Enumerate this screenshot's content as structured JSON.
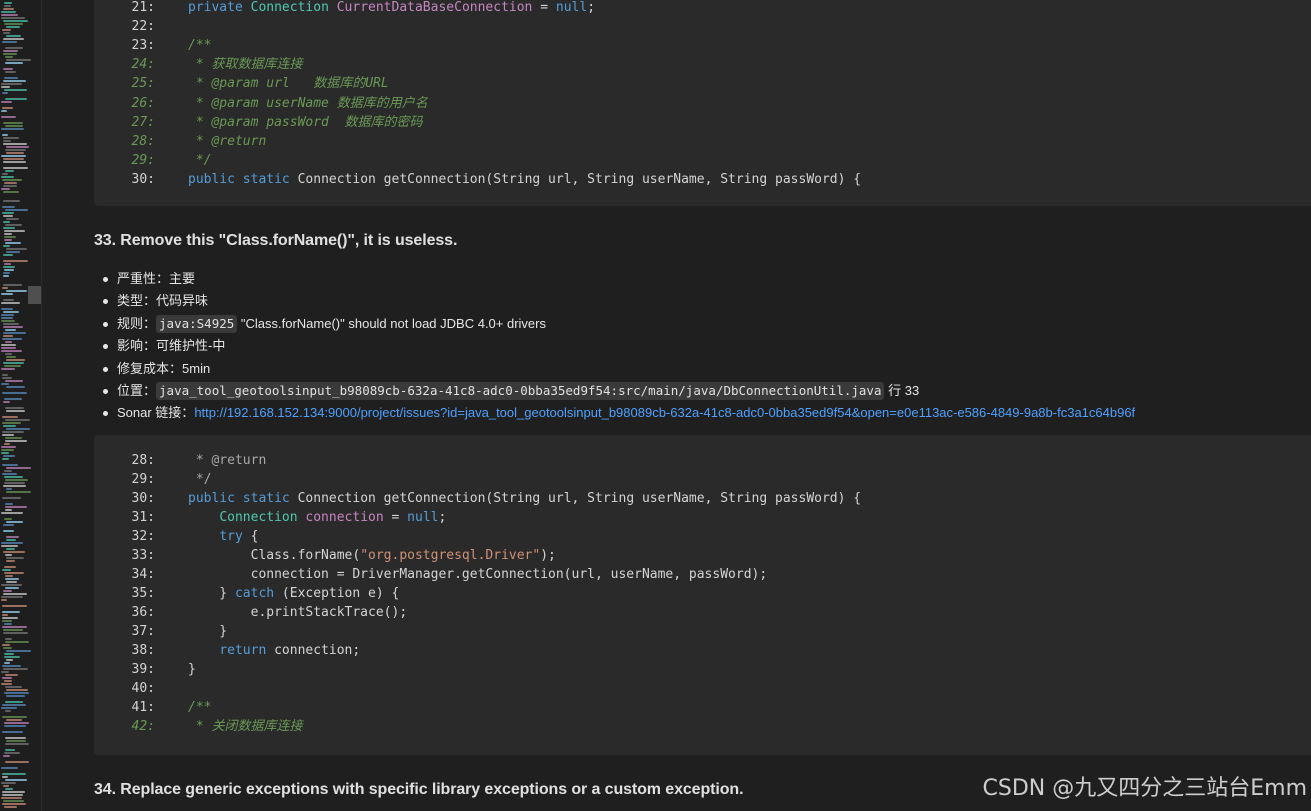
{
  "code_top": {
    "lines": [
      {
        "n": "21:",
        "tokens": [
          {
            "c": "kw",
            "t": "private "
          },
          {
            "c": "type",
            "t": "Connection "
          },
          {
            "c": "var",
            "t": "CurrentDataBaseConnection"
          },
          {
            "c": "plain",
            "t": " = "
          },
          {
            "c": "kw",
            "t": "null"
          },
          {
            "c": "plain",
            "t": ";"
          }
        ]
      },
      {
        "n": "22:",
        "tokens": []
      },
      {
        "n": "23:",
        "tokens": [
          {
            "c": "cmt",
            "t": "/**"
          }
        ]
      },
      {
        "n": "24:",
        "ln": "cm",
        "tokens": [
          {
            "c": "cmt",
            "t": " * 获取数据库连接"
          }
        ]
      },
      {
        "n": "25:",
        "ln": "cm",
        "tokens": [
          {
            "c": "cmt",
            "t": " * @param url   数据库的URL"
          }
        ]
      },
      {
        "n": "26:",
        "ln": "cm",
        "tokens": [
          {
            "c": "cmt",
            "t": " * @param userName 数据库的用户名"
          }
        ]
      },
      {
        "n": "27:",
        "ln": "cm",
        "tokens": [
          {
            "c": "cmt",
            "t": " * @param passWord  数据库的密码"
          }
        ]
      },
      {
        "n": "28:",
        "ln": "cm",
        "tokens": [
          {
            "c": "cmt",
            "t": " * @return"
          }
        ]
      },
      {
        "n": "29:",
        "ln": "cm",
        "tokens": [
          {
            "c": "cmt",
            "t": " */"
          }
        ]
      },
      {
        "n": "30:",
        "tokens": [
          {
            "c": "kw",
            "t": "public "
          },
          {
            "c": "kw",
            "t": "static "
          },
          {
            "c": "plain",
            "t": "Connection getConnection(String url, String userName, String passWord) {"
          }
        ]
      }
    ]
  },
  "issue": {
    "title": "33. Remove this \"Class.forName()\", it is useless.",
    "severity_label": "严重性：",
    "severity": "主要",
    "type_label": "类型：",
    "type": "代码异味",
    "rule_label": "规则：",
    "rule_code": "java:S4925",
    "rule_desc": " \"Class.forName()\" should not load JDBC 4.0+ drivers",
    "impact_label": "影响：",
    "impact": "可维护性-中",
    "cost_label": "修复成本：",
    "cost": "5min",
    "location_label": "位置：",
    "location_code": "java_tool_geotoolsinput_b98089cb-632a-41c8-adc0-0bba35ed9f54:src/main/java/DbConnectionUtil.java",
    "location_line": " 行 33",
    "sonar_label": "Sonar 链接：",
    "sonar_url": "http://192.168.152.134:9000/project/issues?id=java_tool_geotoolsinput_b98089cb-632a-41c8-adc0-0bba35ed9f54&open=e0e113ac-e586-4849-9a8b-fc3a1c64b96f"
  },
  "code_bottom": {
    "lines": [
      {
        "n": "28:",
        "tokens": [
          {
            "c": "cmtg",
            "t": " * @return"
          }
        ]
      },
      {
        "n": "29:",
        "tokens": [
          {
            "c": "cmtg",
            "t": " */"
          }
        ]
      },
      {
        "n": "30:",
        "tokens": [
          {
            "c": "kw",
            "t": "public "
          },
          {
            "c": "kw",
            "t": "static "
          },
          {
            "c": "plain",
            "t": "Connection getConnection(String url, String userName, String passWord) {"
          }
        ]
      },
      {
        "n": "31:",
        "tokens": [
          {
            "c": "plain",
            "t": "    "
          },
          {
            "c": "type",
            "t": "Connection "
          },
          {
            "c": "var",
            "t": "connection"
          },
          {
            "c": "plain",
            "t": " = "
          },
          {
            "c": "kw",
            "t": "null"
          },
          {
            "c": "plain",
            "t": ";"
          }
        ]
      },
      {
        "n": "32:",
        "tokens": [
          {
            "c": "plain",
            "t": "    "
          },
          {
            "c": "kw",
            "t": "try"
          },
          {
            "c": "plain",
            "t": " {"
          }
        ]
      },
      {
        "n": "33:",
        "tokens": [
          {
            "c": "plain",
            "t": "        Class.forName("
          },
          {
            "c": "str",
            "t": "\"org.postgresql.Driver\""
          },
          {
            "c": "plain",
            "t": ");"
          }
        ]
      },
      {
        "n": "34:",
        "tokens": [
          {
            "c": "plain",
            "t": "        connection = DriverManager.getConnection(url, userName, passWord);"
          }
        ]
      },
      {
        "n": "35:",
        "tokens": [
          {
            "c": "plain",
            "t": "    } "
          },
          {
            "c": "kw",
            "t": "catch"
          },
          {
            "c": "plain",
            "t": " (Exception e) {"
          }
        ]
      },
      {
        "n": "36:",
        "tokens": [
          {
            "c": "plain",
            "t": "        e.printStackTrace();"
          }
        ]
      },
      {
        "n": "37:",
        "tokens": [
          {
            "c": "plain",
            "t": "    }"
          }
        ]
      },
      {
        "n": "38:",
        "tokens": [
          {
            "c": "plain",
            "t": "    "
          },
          {
            "c": "kw",
            "t": "return"
          },
          {
            "c": "plain",
            "t": " connection;"
          }
        ]
      },
      {
        "n": "39:",
        "tokens": [
          {
            "c": "plain",
            "t": "}"
          }
        ]
      },
      {
        "n": "40:",
        "tokens": []
      },
      {
        "n": "41:",
        "tokens": [
          {
            "c": "cmt",
            "t": "/**"
          }
        ]
      },
      {
        "n": "42:",
        "ln": "cm",
        "tokens": [
          {
            "c": "cmt",
            "t": " * 关闭数据库连接"
          }
        ]
      }
    ]
  },
  "next_issue_title": "34. Replace generic exceptions with specific library exceptions or a custom exception.",
  "watermark": "CSDN @九又四分之三站台Emm"
}
